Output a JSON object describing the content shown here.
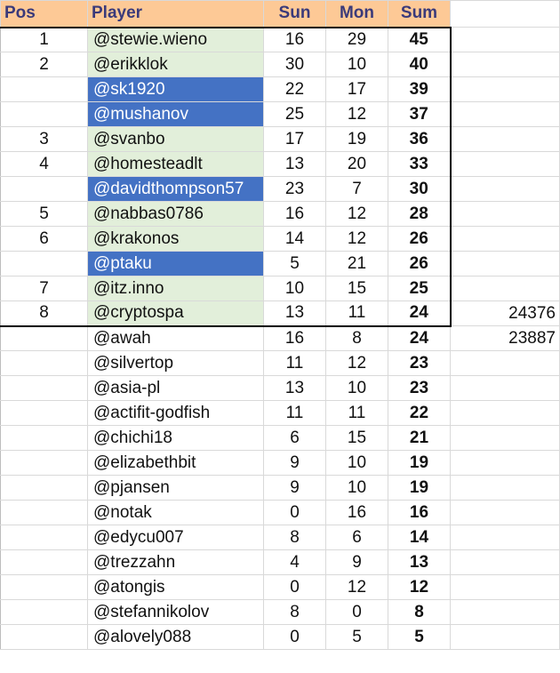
{
  "headers": {
    "pos": "Pos",
    "player": "Player",
    "sun": "Sun",
    "mon": "Mon",
    "sum": "Sum"
  },
  "colors": {
    "header_bg": "#fdc996",
    "header_text": "#3a3a7a",
    "qualified_bg": "#e2efda",
    "highlight_bg": "#4472c4"
  },
  "rows": [
    {
      "pos": "1",
      "player": "@stewie.wieno",
      "sun": "16",
      "mon": "29",
      "sum": "45",
      "extra": "",
      "style": "green"
    },
    {
      "pos": "2",
      "player": "@erikklok",
      "sun": "30",
      "mon": "10",
      "sum": "40",
      "extra": "",
      "style": "green"
    },
    {
      "pos": "",
      "player": "@sk1920",
      "sun": "22",
      "mon": "17",
      "sum": "39",
      "extra": "",
      "style": "blue"
    },
    {
      "pos": "",
      "player": "@mushanov",
      "sun": "25",
      "mon": "12",
      "sum": "37",
      "extra": "",
      "style": "blue"
    },
    {
      "pos": "3",
      "player": "@svanbo",
      "sun": "17",
      "mon": "19",
      "sum": "36",
      "extra": "",
      "style": "green"
    },
    {
      "pos": "4",
      "player": "@homesteadlt",
      "sun": "13",
      "mon": "20",
      "sum": "33",
      "extra": "",
      "style": "green"
    },
    {
      "pos": "",
      "player": "@davidthompson57",
      "sun": "23",
      "mon": "7",
      "sum": "30",
      "extra": "",
      "style": "blue"
    },
    {
      "pos": "5",
      "player": "@nabbas0786",
      "sun": "16",
      "mon": "12",
      "sum": "28",
      "extra": "",
      "style": "green"
    },
    {
      "pos": "6",
      "player": "@krakonos",
      "sun": "14",
      "mon": "12",
      "sum": "26",
      "extra": "",
      "style": "green"
    },
    {
      "pos": "",
      "player": "@ptaku",
      "sun": "5",
      "mon": "21",
      "sum": "26",
      "extra": "",
      "style": "blue"
    },
    {
      "pos": "7",
      "player": "@itz.inno",
      "sun": "10",
      "mon": "15",
      "sum": "25",
      "extra": "",
      "style": "green"
    },
    {
      "pos": "8",
      "player": "@cryptospa",
      "sun": "13",
      "mon": "11",
      "sum": "24",
      "extra": "24376",
      "style": "green"
    },
    {
      "pos": "",
      "player": "@awah",
      "sun": "16",
      "mon": "8",
      "sum": "24",
      "extra": "23887",
      "style": "plain"
    },
    {
      "pos": "",
      "player": "@silvertop",
      "sun": "11",
      "mon": "12",
      "sum": "23",
      "extra": "",
      "style": "plain"
    },
    {
      "pos": "",
      "player": "@asia-pl",
      "sun": "13",
      "mon": "10",
      "sum": "23",
      "extra": "",
      "style": "plain"
    },
    {
      "pos": "",
      "player": "@actifit-godfish",
      "sun": "11",
      "mon": "11",
      "sum": "22",
      "extra": "",
      "style": "plain"
    },
    {
      "pos": "",
      "player": "@chichi18",
      "sun": "6",
      "mon": "15",
      "sum": "21",
      "extra": "",
      "style": "plain"
    },
    {
      "pos": "",
      "player": "@elizabethbit",
      "sun": "9",
      "mon": "10",
      "sum": "19",
      "extra": "",
      "style": "plain"
    },
    {
      "pos": "",
      "player": "@pjansen",
      "sun": "9",
      "mon": "10",
      "sum": "19",
      "extra": "",
      "style": "plain"
    },
    {
      "pos": "",
      "player": "@notak",
      "sun": "0",
      "mon": "16",
      "sum": "16",
      "extra": "",
      "style": "plain"
    },
    {
      "pos": "",
      "player": "@edycu007",
      "sun": "8",
      "mon": "6",
      "sum": "14",
      "extra": "",
      "style": "plain"
    },
    {
      "pos": "",
      "player": "@trezzahn",
      "sun": "4",
      "mon": "9",
      "sum": "13",
      "extra": "",
      "style": "plain"
    },
    {
      "pos": "",
      "player": "@atongis",
      "sun": "0",
      "mon": "12",
      "sum": "12",
      "extra": "",
      "style": "plain"
    },
    {
      "pos": "",
      "player": "@stefannikolov",
      "sun": "8",
      "mon": "0",
      "sum": "8",
      "extra": "",
      "style": "plain"
    },
    {
      "pos": "",
      "player": "@alovely088",
      "sun": "0",
      "mon": "5",
      "sum": "5",
      "extra": "",
      "style": "plain"
    }
  ]
}
